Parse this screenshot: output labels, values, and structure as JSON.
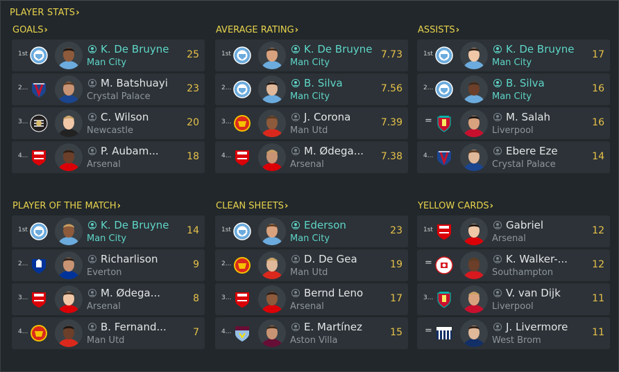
{
  "header": {
    "title": "PLAYER STATS"
  },
  "colors": {
    "accent": "#e8d44d",
    "highlight": "#5fd6c9",
    "value": "#e8c24a"
  },
  "categories": [
    {
      "title": "GOALS",
      "rows": [
        {
          "rank": "1st",
          "club_badge": "man-city-badge",
          "name": "K. De Bruyne",
          "club": "Man City",
          "value": "25",
          "highlight": true
        },
        {
          "rank": "2...",
          "club_badge": "crystal-palace-badge",
          "name": "M. Batshuayi",
          "club": "Crystal Palace",
          "value": "23",
          "highlight": false
        },
        {
          "rank": "3...",
          "club_badge": "newcastle-badge",
          "name": "C. Wilson",
          "club": "Newcastle",
          "value": "20",
          "highlight": false
        },
        {
          "rank": "4...",
          "club_badge": "arsenal-badge",
          "name": "P. Aubam...",
          "club": "Arsenal",
          "value": "18",
          "highlight": false
        }
      ]
    },
    {
      "title": "AVERAGE RATING",
      "rows": [
        {
          "rank": "1st",
          "club_badge": "man-city-badge",
          "name": "K. De Bruyne",
          "club": "Man City",
          "value": "7.73",
          "highlight": true
        },
        {
          "rank": "2...",
          "club_badge": "man-city-badge",
          "name": "B. Silva",
          "club": "Man City",
          "value": "7.56",
          "highlight": true
        },
        {
          "rank": "3...",
          "club_badge": "man-utd-badge",
          "name": "J. Corona",
          "club": "Man Utd",
          "value": "7.39",
          "highlight": false
        },
        {
          "rank": "4...",
          "club_badge": "arsenal-badge",
          "name": "M. Ødega...",
          "club": "Arsenal",
          "value": "7.38",
          "highlight": false
        }
      ]
    },
    {
      "title": "ASSISTS",
      "rows": [
        {
          "rank": "1st",
          "club_badge": "man-city-badge",
          "name": "K. De Bruyne",
          "club": "Man City",
          "value": "17",
          "highlight": true
        },
        {
          "rank": "2...",
          "club_badge": "man-city-badge",
          "name": "B. Silva",
          "club": "Man City",
          "value": "16",
          "highlight": true
        },
        {
          "rank": "=",
          "club_badge": "liverpool-badge",
          "name": "M. Salah",
          "club": "Liverpool",
          "value": "16",
          "highlight": false
        },
        {
          "rank": "4...",
          "club_badge": "crystal-palace-badge",
          "name": "Ebere Eze",
          "club": "Crystal Palace",
          "value": "14",
          "highlight": false
        }
      ]
    },
    {
      "title": "PLAYER OF THE MATCH",
      "rows": [
        {
          "rank": "1st",
          "club_badge": "man-city-badge",
          "name": "K. De Bruyne",
          "club": "Man City",
          "value": "14",
          "highlight": true
        },
        {
          "rank": "2...",
          "club_badge": "everton-badge",
          "name": "Richarlison",
          "club": "Everton",
          "value": "9",
          "highlight": false
        },
        {
          "rank": "3...",
          "club_badge": "arsenal-badge",
          "name": "M. Ødega...",
          "club": "Arsenal",
          "value": "8",
          "highlight": false
        },
        {
          "rank": "4...",
          "club_badge": "man-utd-badge",
          "name": "B. Fernand...",
          "club": "Man Utd",
          "value": "7",
          "highlight": false
        }
      ]
    },
    {
      "title": "CLEAN SHEETS",
      "rows": [
        {
          "rank": "1st",
          "club_badge": "man-city-badge",
          "name": "Ederson",
          "club": "Man City",
          "value": "23",
          "highlight": true
        },
        {
          "rank": "2...",
          "club_badge": "man-utd-badge",
          "name": "D. De Gea",
          "club": "Man Utd",
          "value": "19",
          "highlight": false
        },
        {
          "rank": "3...",
          "club_badge": "arsenal-badge",
          "name": "Bernd Leno",
          "club": "Arsenal",
          "value": "17",
          "highlight": false
        },
        {
          "rank": "4...",
          "club_badge": "aston-villa-badge",
          "name": "E. Martínez",
          "club": "Aston Villa",
          "value": "15",
          "highlight": false
        }
      ]
    },
    {
      "title": "YELLOW CARDS",
      "rows": [
        {
          "rank": "1st",
          "club_badge": "arsenal-badge",
          "name": "Gabriel",
          "club": "Arsenal",
          "value": "12",
          "highlight": false
        },
        {
          "rank": "=",
          "club_badge": "southampton-badge",
          "name": "K. Walker-...",
          "club": "Southampton",
          "value": "12",
          "highlight": false
        },
        {
          "rank": "3...",
          "club_badge": "liverpool-badge",
          "name": "V. van Dijk",
          "club": "Liverpool",
          "value": "11",
          "highlight": false
        },
        {
          "rank": "=",
          "club_badge": "west-brom-badge",
          "name": "J. Livermore",
          "club": "West Brom",
          "value": "11",
          "highlight": false
        }
      ]
    }
  ]
}
